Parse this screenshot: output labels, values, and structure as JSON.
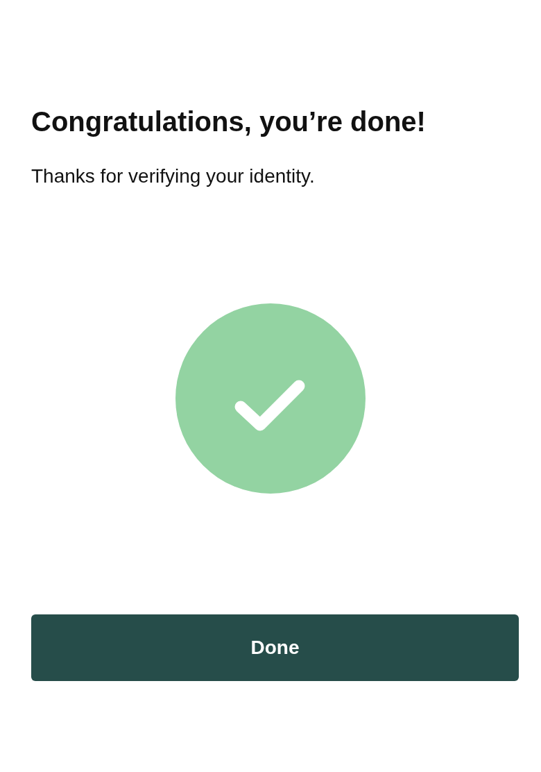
{
  "title": "Congratulations, you’re done!",
  "message": "Thanks for verifying your identity.",
  "button": {
    "label": "Done"
  }
}
